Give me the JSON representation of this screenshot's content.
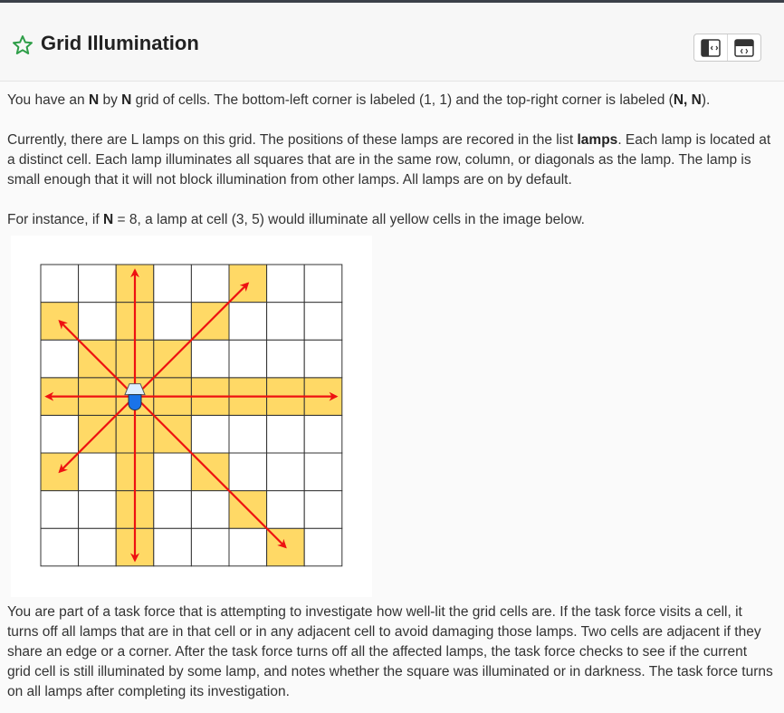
{
  "header": {
    "title": "Grid Illumination",
    "icons": [
      "star-outline-icon",
      "split-view-icon",
      "full-view-icon"
    ]
  },
  "description": {
    "p1_text1": "You have an ",
    "p1_b1": "N",
    "p1_text2": " by ",
    "p1_b2": "N",
    "p1_text3": " grid of cells. The bottom-left corner is labeled (1, 1) and the top-right corner is labeled (",
    "p1_b3": "N, N",
    "p1_text4": ").",
    "p2_text1": "Currently, there are L lamps on this grid. The positions of these lamps are recored in the list ",
    "p2_b1": "lamps",
    "p2_text2": ". Each lamp is located at a distinct cell. Each lamp illuminates all squares that are in the same row, column, or diagonals as the lamp. The lamp is small enough that it will not block illumination from other lamps. All lamps are on by default.",
    "p3_text1": "For instance, if ",
    "p3_b1": "N",
    "p3_text2": " = 8, a lamp at cell (3, 5) would illuminate all yellow cells in the image below.",
    "p4": "You are part of a task force that is attempting to investigate how well-lit the grid cells are. If the task force visits a cell, it turns off all lamps that are in that cell or in any adjacent cell to avoid damaging those lamps. Two cells are adjacent if they share an edge or a corner. After the task force turns off all the affected lamps, the task force checks to see if the current grid cell is still illuminated by some lamp, and notes whether the square was illuminated or in darkness. The task force turns on all lamps after completing its investigation."
  },
  "figure": {
    "n": 8,
    "lamp": [
      3,
      5
    ],
    "colors": {
      "lit": "#ffd966",
      "unlit": "#ffffff",
      "grid": "#333333",
      "arrow": "#ee1111",
      "lamp_top": "#ddeeff",
      "lamp_bottom": "#1a73e8"
    }
  }
}
